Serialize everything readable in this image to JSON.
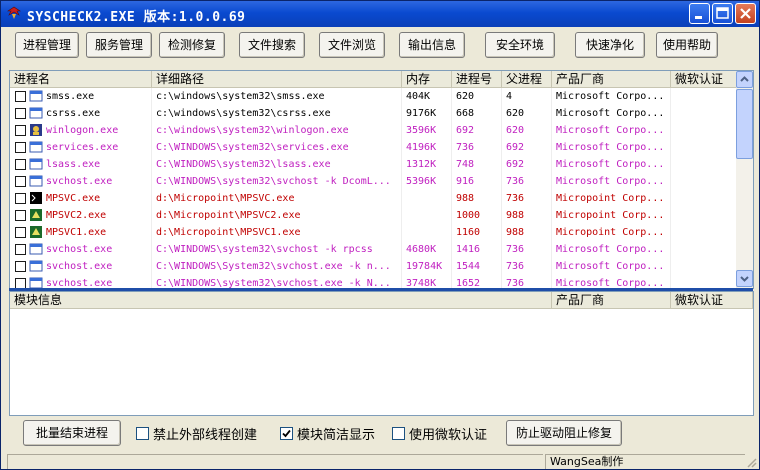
{
  "window": {
    "title": "SYSCHECK2.EXE  版本:1.0.0.69",
    "icon": "winged-app-icon"
  },
  "toolbar": {
    "buttons": [
      {
        "label": "进程管理"
      },
      {
        "label": "服务管理"
      },
      {
        "label": "检测修复"
      },
      {
        "label": "文件搜索"
      },
      {
        "label": "文件浏览"
      },
      {
        "label": "输出信息"
      },
      {
        "label": "安全环境"
      },
      {
        "label": "快速净化"
      },
      {
        "label": "使用帮助"
      }
    ]
  },
  "process_table": {
    "columns": [
      "进程名",
      "详细路径",
      "内存",
      "进程号",
      "父进程",
      "产品厂商",
      "微软认证"
    ],
    "rows": [
      {
        "name": "smss.exe",
        "path": "c:\\windows\\system32\\smss.exe",
        "memory": "404K",
        "pid": "620",
        "ppid": "4",
        "vendor": "Microsoft Corpo...",
        "cert": "",
        "color": "#000000",
        "icon": "window-icon"
      },
      {
        "name": "csrss.exe",
        "path": "c:\\windows\\system32\\csrss.exe",
        "memory": "9176K",
        "pid": "668",
        "ppid": "620",
        "vendor": "Microsoft Corpo...",
        "cert": "",
        "color": "#000000",
        "icon": "window-icon"
      },
      {
        "name": "winlogon.exe",
        "path": "c:\\windows\\system32\\winlogon.exe",
        "memory": "3596K",
        "pid": "692",
        "ppid": "620",
        "vendor": "Microsoft Corpo...",
        "cert": "",
        "color": "#c020c0",
        "icon": "winlogon-icon"
      },
      {
        "name": "services.exe",
        "path": "C:\\WINDOWS\\system32\\services.exe",
        "memory": "4196K",
        "pid": "736",
        "ppid": "692",
        "vendor": "Microsoft Corpo...",
        "cert": "",
        "color": "#c020c0",
        "icon": "window-icon"
      },
      {
        "name": "lsass.exe",
        "path": "C:\\WINDOWS\\system32\\lsass.exe",
        "memory": "1312K",
        "pid": "748",
        "ppid": "692",
        "vendor": "Microsoft Corpo...",
        "cert": "",
        "color": "#c020c0",
        "icon": "window-icon"
      },
      {
        "name": "svchost.exe",
        "path": "C:\\WINDOWS\\system32\\svchost -k DcomL...",
        "memory": "5396K",
        "pid": "916",
        "ppid": "736",
        "vendor": "Microsoft Corpo...",
        "cert": "",
        "color": "#c020c0",
        "icon": "window-icon"
      },
      {
        "name": "MPSVC.exe",
        "path": "d:\\Micropoint\\MPSVC.exe",
        "memory": "",
        "pid": "988",
        "ppid": "736",
        "vendor": "Micropoint Corp...",
        "cert": "",
        "color": "#c00000",
        "icon": "console-icon"
      },
      {
        "name": "MPSVC2.exe",
        "path": "d:\\Micropoint\\MPSVC2.exe",
        "memory": "",
        "pid": "1000",
        "ppid": "988",
        "vendor": "Micropoint Corp...",
        "cert": "",
        "color": "#c00000",
        "icon": "micropoint-icon"
      },
      {
        "name": "MPSVC1.exe",
        "path": "d:\\Micropoint\\MPSVC1.exe",
        "memory": "",
        "pid": "1160",
        "ppid": "988",
        "vendor": "Micropoint Corp...",
        "cert": "",
        "color": "#c00000",
        "icon": "micropoint-icon"
      },
      {
        "name": "svchost.exe",
        "path": "C:\\WINDOWS\\system32\\svchost -k rpcss",
        "memory": "4680K",
        "pid": "1416",
        "ppid": "736",
        "vendor": "Microsoft Corpo...",
        "cert": "",
        "color": "#c020c0",
        "icon": "window-icon"
      },
      {
        "name": "svchost.exe",
        "path": "C:\\WINDOWS\\System32\\svchost.exe -k n...",
        "memory": "19784K",
        "pid": "1544",
        "ppid": "736",
        "vendor": "Microsoft Corpo...",
        "cert": "",
        "color": "#c020c0",
        "icon": "window-icon"
      },
      {
        "name": "svchost.exe",
        "path": "C:\\WINDOWS\\system32\\svchost.exe -k N...",
        "memory": "3748K",
        "pid": "1652",
        "ppid": "736",
        "vendor": "Microsoft Corpo...",
        "cert": "",
        "color": "#c020c0",
        "icon": "window-icon"
      }
    ]
  },
  "module_table": {
    "columns": [
      "模块信息",
      "产品厂商",
      "微软认证"
    ]
  },
  "bottom": {
    "batch_end_button": "批量结束进程",
    "checkboxes": [
      {
        "label": "禁止外部线程创建",
        "checked": false
      },
      {
        "label": "模块简洁显示",
        "checked": true
      },
      {
        "label": "使用微软认证",
        "checked": false
      }
    ],
    "driver_button": "防止驱动阻止修复"
  },
  "status": {
    "author": "WangSea制作"
  }
}
